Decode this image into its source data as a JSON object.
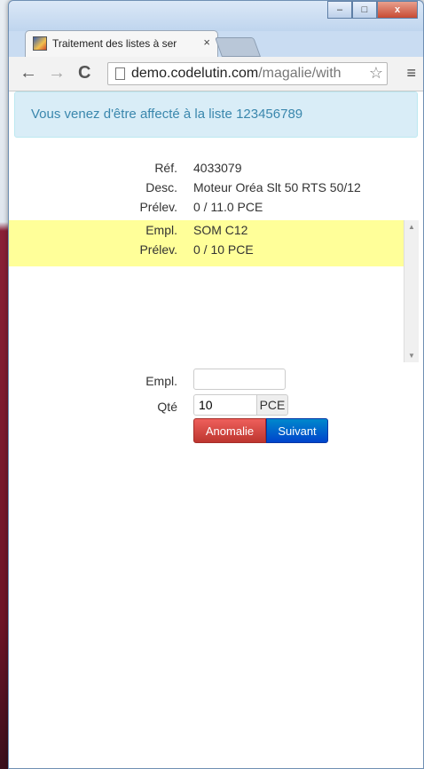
{
  "browser": {
    "tab_title": "Traitement des listes à ser",
    "tab_close": "×",
    "url_domain": "demo.codelutin.com",
    "url_rest": "/magalie/with",
    "window_controls": [
      "–",
      "□",
      "x"
    ]
  },
  "alert": {
    "message": "Vous venez d'être affecté à la liste 123456789"
  },
  "article": {
    "ref_label": "Réf.",
    "ref_value": "4033079",
    "desc_label": "Desc.",
    "desc_value": "Moteur Oréa Slt 50 RTS 50/12",
    "prelev_label": "Prélev.",
    "prelev_value": "0 / 11.0 PCE"
  },
  "location": {
    "empl_label": "Empl.",
    "empl_value": "SOM C12",
    "prelev_label": "Prélev.",
    "prelev_value": "0 / 10 PCE"
  },
  "form": {
    "empl_label": "Empl.",
    "empl_value": "",
    "qty_label": "Qté",
    "qty_value": "10",
    "qty_unit": "PCE",
    "anomaly_button": "Anomalie",
    "next_button": "Suivant"
  },
  "colors": {
    "alert_bg": "#d9edf7",
    "alert_text": "#3a87ad",
    "highlight": "#ffff99",
    "danger": "#bd362f",
    "primary": "#0044cc"
  }
}
